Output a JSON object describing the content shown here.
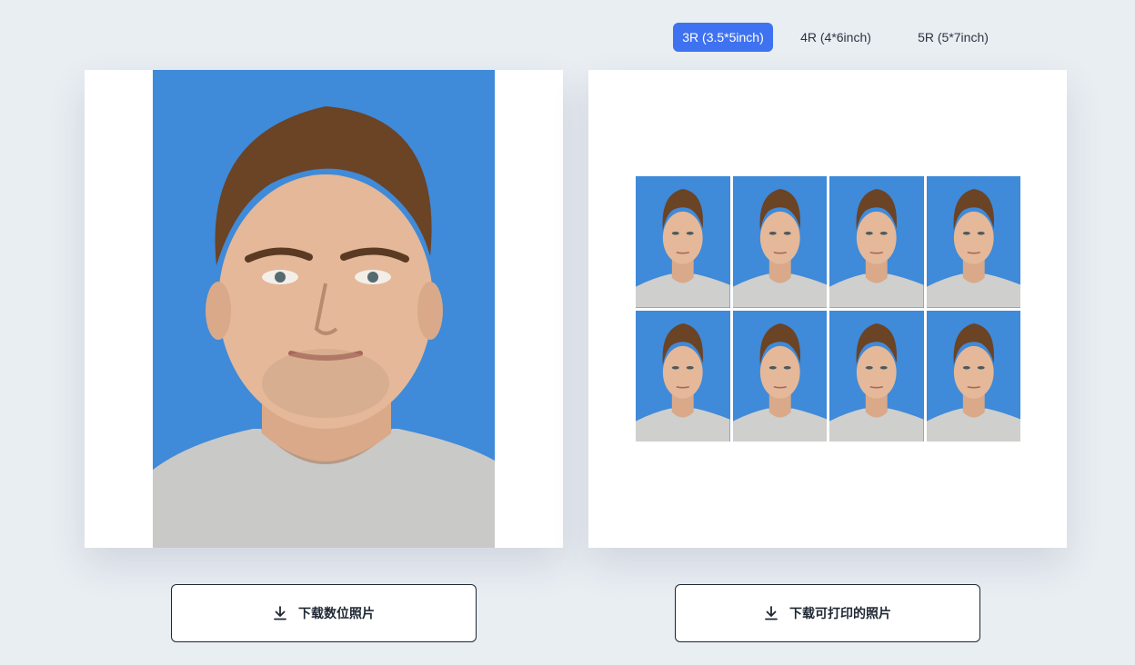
{
  "size_tabs": [
    {
      "label": "3R (3.5*5inch)",
      "active": true
    },
    {
      "label": "4R (4*6inch)",
      "active": false
    },
    {
      "label": "5R (5*7inch)",
      "active": false
    }
  ],
  "digital_preview": {
    "background_color": "#3f8ad9"
  },
  "print_sheet": {
    "rows": 2,
    "columns": 4,
    "photo_count": 8
  },
  "buttons": {
    "download_digital_label": "下载数位照片",
    "download_printable_label": "下载可打印的照片",
    "icon": "download-icon"
  },
  "colors": {
    "accent": "#3f72f0",
    "page_background": "#e9eef3",
    "photo_background": "#3f8ad9"
  }
}
